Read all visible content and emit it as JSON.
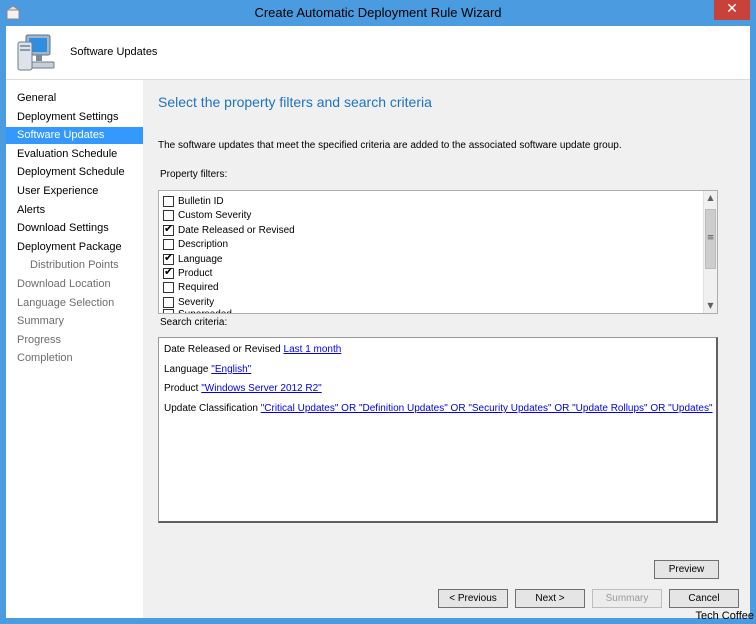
{
  "window": {
    "title": "Create Automatic Deployment Rule Wizard",
    "close_glyph": "✕"
  },
  "header": {
    "title": "Software Updates",
    "icon": "computer-icon"
  },
  "nav": {
    "items": [
      {
        "label": "General",
        "state": "normal"
      },
      {
        "label": "Deployment Settings",
        "state": "normal"
      },
      {
        "label": "Software Updates",
        "state": "active"
      },
      {
        "label": "Evaluation Schedule",
        "state": "normal"
      },
      {
        "label": "Deployment Schedule",
        "state": "normal"
      },
      {
        "label": "User Experience",
        "state": "normal"
      },
      {
        "label": "Alerts",
        "state": "normal"
      },
      {
        "label": "Download Settings",
        "state": "normal"
      },
      {
        "label": "Deployment Package",
        "state": "normal"
      },
      {
        "label": "Distribution Points",
        "state": "disabled-sub"
      },
      {
        "label": "Download Location",
        "state": "disabled"
      },
      {
        "label": "Language Selection",
        "state": "disabled"
      },
      {
        "label": "Summary",
        "state": "disabled"
      },
      {
        "label": "Progress",
        "state": "disabled"
      },
      {
        "label": "Completion",
        "state": "disabled"
      }
    ]
  },
  "main": {
    "heading": "Select the property filters and search criteria",
    "description": "The software updates that meet the specified criteria are added to the associated software update group.",
    "property_filters_label": "Property filters:",
    "property_filters": [
      {
        "label": "Bulletin ID",
        "checked": false
      },
      {
        "label": "Custom Severity",
        "checked": false
      },
      {
        "label": "Date Released or Revised",
        "checked": true
      },
      {
        "label": "Description",
        "checked": false
      },
      {
        "label": "Language",
        "checked": true
      },
      {
        "label": "Product",
        "checked": true
      },
      {
        "label": "Required",
        "checked": false
      },
      {
        "label": "Severity",
        "checked": false
      },
      {
        "label": "Superseded",
        "checked": false
      }
    ],
    "check_glyph": "✔",
    "scroll": {
      "up": "▲",
      "down": "▼",
      "thumb": "≡"
    },
    "search_criteria_label": "Search criteria:",
    "criteria": [
      {
        "prefix": "Date Released or Revised ",
        "link": "Last 1 month"
      },
      {
        "prefix": "Language ",
        "link": "\"English\""
      },
      {
        "prefix": "Product ",
        "link": "\"Windows Server 2012 R2\""
      },
      {
        "prefix": "Update Classification ",
        "link": "\"Critical Updates\" OR \"Definition Updates\" OR \"Security Updates\" OR \"Update Rollups\" OR \"Updates\""
      }
    ],
    "preview_button": "Preview"
  },
  "footer": {
    "previous_button": "< Previous",
    "next_button": "Next >",
    "summary_button": "Summary",
    "cancel_button": "Cancel"
  },
  "watermark": "Tech Coffee",
  "colors": {
    "titlebar": "#4a9be0",
    "close": "#c7423b",
    "nav_active": "#3399ff",
    "heading": "#1e73be",
    "link": "#0000ee"
  }
}
